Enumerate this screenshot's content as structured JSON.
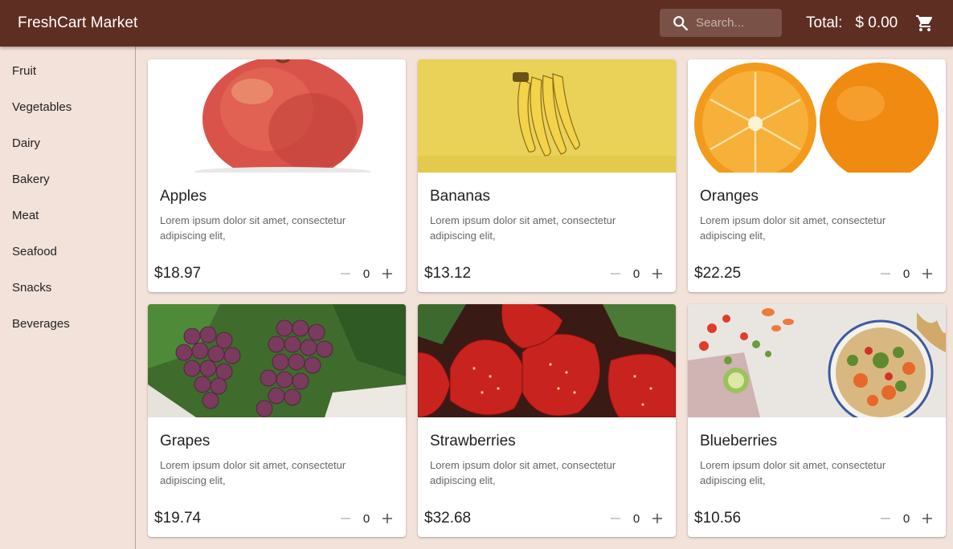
{
  "header": {
    "title": "FreshCart Market",
    "search_placeholder": "Search...",
    "total_label": "Total:",
    "total_value": "$ 0.00",
    "cart_icon": "shopping-cart-icon",
    "search_icon": "search-icon"
  },
  "sidebar": {
    "items": [
      {
        "label": "Fruit"
      },
      {
        "label": "Vegetables"
      },
      {
        "label": "Dairy"
      },
      {
        "label": "Bakery"
      },
      {
        "label": "Meat"
      },
      {
        "label": "Seafood"
      },
      {
        "label": "Snacks"
      },
      {
        "label": "Beverages"
      }
    ]
  },
  "products": [
    {
      "name": "Apples",
      "description": "Lorem ipsum dolor sit amet, consectetur adipiscing elit,",
      "price": "$18.97",
      "quantity": "0",
      "image": "apple"
    },
    {
      "name": "Bananas",
      "description": "Lorem ipsum dolor sit amet, consectetur adipiscing elit,",
      "price": "$13.12",
      "quantity": "0",
      "image": "bananas"
    },
    {
      "name": "Oranges",
      "description": "Lorem ipsum dolor sit amet, consectetur adipiscing elit,",
      "price": "$22.25",
      "quantity": "0",
      "image": "oranges"
    },
    {
      "name": "Grapes",
      "description": "Lorem ipsum dolor sit amet, consectetur adipiscing elit,",
      "price": "$19.74",
      "quantity": "0",
      "image": "grapes"
    },
    {
      "name": "Strawberries",
      "description": "Lorem ipsum dolor sit amet, consectetur adipiscing elit,",
      "price": "$32.68",
      "quantity": "0",
      "image": "strawberries"
    },
    {
      "name": "Blueberries",
      "description": "Lorem ipsum dolor sit amet, consectetur adipiscing elit,",
      "price": "$10.56",
      "quantity": "0",
      "image": "salad-bowl"
    }
  ],
  "colors": {
    "header_bg": "#5f2e22",
    "page_bg": "#f2e2da",
    "card_bg": "#ffffff"
  }
}
